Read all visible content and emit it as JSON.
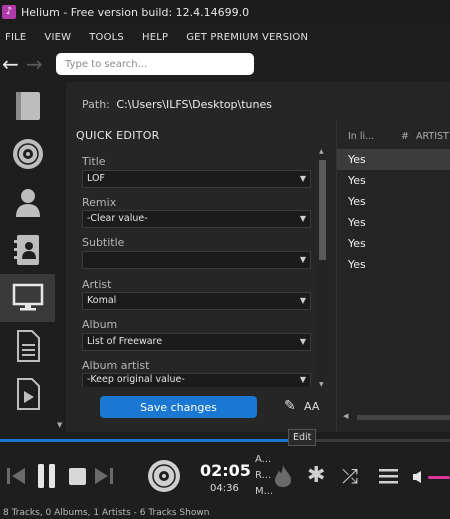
{
  "window": {
    "title": "Helium - Free version build: 12.4.14699.0"
  },
  "menu": [
    "FILE",
    "VIEW",
    "TOOLS",
    "HELP",
    "GET PREMIUM VERSION"
  ],
  "search": {
    "placeholder": "Type to search...",
    "value": ""
  },
  "path": {
    "label": "Path:",
    "value": "C:\\Users\\ILFS\\Desktop\\tunes"
  },
  "quick_editor": {
    "title": "QUICK EDITOR",
    "fields": [
      {
        "label": "Title",
        "value": "LOF"
      },
      {
        "label": "Remix",
        "value": "-Clear value-"
      },
      {
        "label": "Subtitle",
        "value": ""
      },
      {
        "label": "Artist",
        "value": "Komal"
      },
      {
        "label": "Album",
        "value": "List of Freeware"
      },
      {
        "label": "Album artist",
        "value": "-Keep original value-"
      }
    ],
    "save_label": "Save changes",
    "aa_label": "AA",
    "edit_tooltip": "Edit"
  },
  "track_table": {
    "columns": [
      "In li...",
      "#",
      "ARTIST"
    ],
    "rows": [
      "Yes",
      "Yes",
      "Yes",
      "Yes",
      "Yes",
      "Yes"
    ]
  },
  "player": {
    "elapsed": "02:05",
    "duration": "04:36",
    "progress": 0.7,
    "now_playing": [
      "A...",
      "R...",
      "M..."
    ]
  },
  "status": "8 Tracks, 0 Albums, 1 Artists - 6 Tracks Shown",
  "colors": {
    "accent": "#1a78d2",
    "volume": "#e0359c",
    "app_icon": "#b03ba8"
  },
  "icons": {
    "sidebar": [
      "library-icon",
      "disc-icon",
      "artist-icon",
      "contacts-icon",
      "monitor-icon",
      "document-icon",
      "video-icon"
    ],
    "player": [
      "previous-icon",
      "pause-icon",
      "stop-icon",
      "next-icon",
      "disc-icon",
      "flame-icon",
      "asterisk-icon",
      "shuffle-icon",
      "menu-icon",
      "volume-icon"
    ]
  }
}
